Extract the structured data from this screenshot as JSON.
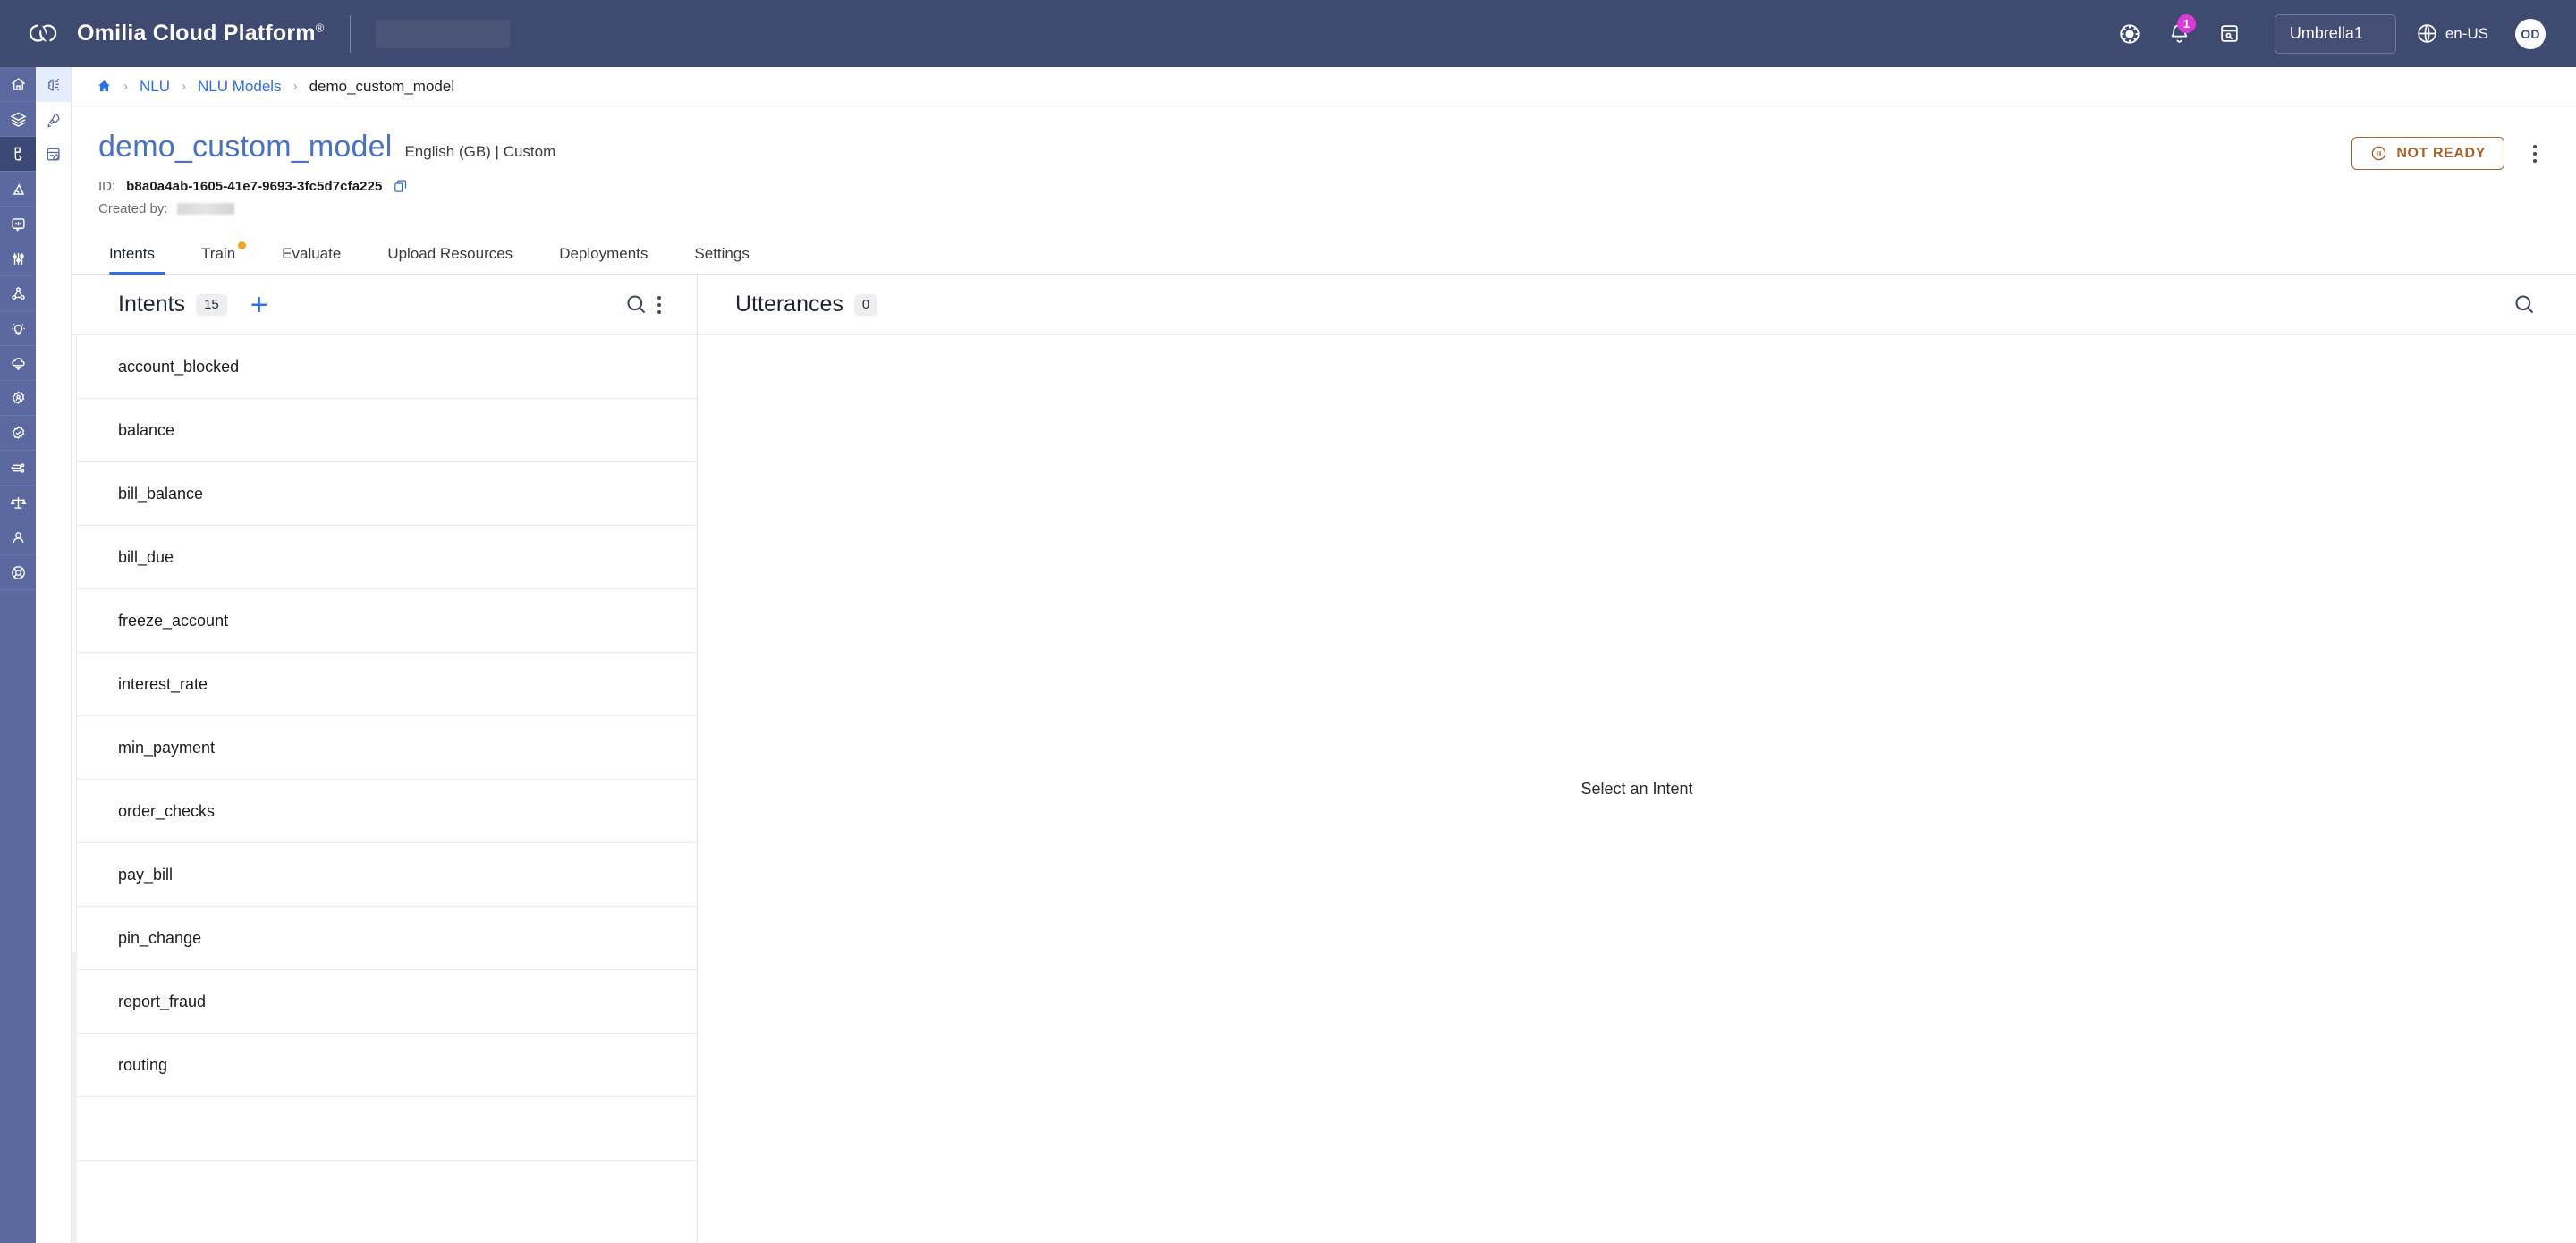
{
  "header": {
    "brand_name": "Omilia Cloud Platform",
    "brand_trademark": "®",
    "logo_icon": "omilia-cloud-logo",
    "redacted_field": "",
    "icons": [
      {
        "name": "theme-settings-icon",
        "label": "theme-settings"
      },
      {
        "name": "notifications-bell-icon",
        "label": "notifications",
        "badge": "1"
      },
      {
        "name": "notes-edit-icon",
        "label": "notes"
      }
    ],
    "tenant": "Umbrella1",
    "language": "en-US",
    "language_icon": "globe-icon",
    "avatar_initials": "OD",
    "accent_badge_color": "#d83bd8",
    "topbar_color": "#3f4a70"
  },
  "rail": {
    "items": [
      {
        "name": "home",
        "icon": "home-icon",
        "active": false
      },
      {
        "name": "layers",
        "icon": "layers-icon",
        "active": false
      },
      {
        "name": "call-flows",
        "icon": "phone-flow-icon",
        "active": true
      },
      {
        "name": "analytics",
        "icon": "analytics-icon",
        "active": false
      },
      {
        "name": "voice-biometrics",
        "icon": "speech-bubble-icon",
        "active": false
      },
      {
        "name": "tuning",
        "icon": "sliders-icon",
        "active": false
      },
      {
        "name": "graph",
        "icon": "network-nodes-icon",
        "active": false
      },
      {
        "name": "insights",
        "icon": "lightbulb-icon",
        "active": false
      },
      {
        "name": "cloud",
        "icon": "cloud-icon",
        "active": false
      },
      {
        "name": "identity",
        "icon": "user-badge-icon",
        "active": false
      },
      {
        "name": "verification",
        "icon": "check-badge-icon",
        "active": false
      },
      {
        "name": "integrations",
        "icon": "circuit-chip-icon",
        "active": false
      },
      {
        "name": "compliance",
        "icon": "scales-icon",
        "active": false
      },
      {
        "name": "users",
        "icon": "person-icon",
        "active": false
      },
      {
        "name": "support",
        "icon": "lifebuoy-icon",
        "active": false
      }
    ]
  },
  "subrail": {
    "items": [
      {
        "name": "nlu-models",
        "icon": "brain-icon",
        "active": true
      },
      {
        "name": "deployments",
        "icon": "rocket-icon",
        "active": false
      },
      {
        "name": "annotations",
        "icon": "form-edit-icon",
        "active": false
      }
    ]
  },
  "breadcrumb": {
    "home_icon": "home-icon",
    "separator": "›",
    "items": [
      {
        "label": "NLU",
        "link": true
      },
      {
        "label": "NLU Models",
        "link": true
      },
      {
        "label": "demo_custom_model",
        "link": false
      }
    ]
  },
  "page": {
    "title": "demo_custom_model",
    "meta": "English (GB) | Custom",
    "id_label": "ID:",
    "id_value": "b8a0a4ab-1605-41e7-9693-3fc5d7cfa225",
    "copy_icon": "copy-icon",
    "created_by_label": "Created by:",
    "created_by_value": "",
    "status": {
      "label": "NOT READY",
      "icon": "pause-circle-icon",
      "color": "#a4622e"
    },
    "menu_icon": "kebab-menu-icon"
  },
  "tabs": [
    {
      "label": "Intents",
      "active": true,
      "dot": false
    },
    {
      "label": "Train",
      "active": false,
      "dot": true
    },
    {
      "label": "Evaluate",
      "active": false,
      "dot": false
    },
    {
      "label": "Upload Resources",
      "active": false,
      "dot": false
    },
    {
      "label": "Deployments",
      "active": false,
      "dot": false
    },
    {
      "label": "Settings",
      "active": false,
      "dot": false
    }
  ],
  "intents_panel": {
    "title": "Intents",
    "count": "15",
    "add_icon": "plus-icon",
    "search_icon": "search-icon",
    "menu_icon": "kebab-menu-icon",
    "items": [
      {
        "name": "account_blocked"
      },
      {
        "name": "balance"
      },
      {
        "name": "bill_balance"
      },
      {
        "name": "bill_due"
      },
      {
        "name": "freeze_account"
      },
      {
        "name": "interest_rate"
      },
      {
        "name": "min_payment"
      },
      {
        "name": "order_checks"
      },
      {
        "name": "pay_bill"
      },
      {
        "name": "pin_change"
      },
      {
        "name": "report_fraud"
      },
      {
        "name": "routing"
      },
      {
        "name": ""
      }
    ]
  },
  "utterances_panel": {
    "title": "Utterances",
    "count": "0",
    "search_icon": "search-icon",
    "empty_message": "Select an Intent"
  }
}
